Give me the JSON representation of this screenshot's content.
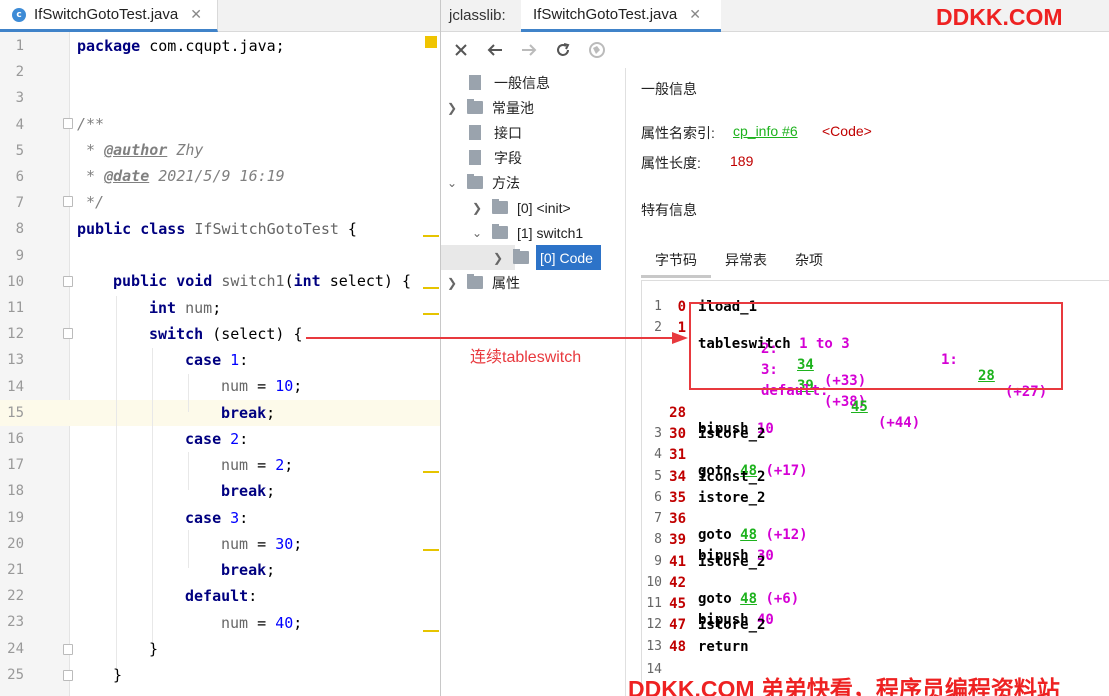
{
  "editor": {
    "tab_label": "IfSwitchGotoTest.java",
    "tab_icon_letter": "c",
    "lines": [
      {
        "n": "1"
      },
      {
        "n": "2"
      },
      {
        "n": "3"
      },
      {
        "n": "4"
      },
      {
        "n": "5"
      },
      {
        "n": "6"
      },
      {
        "n": "7"
      },
      {
        "n": "8"
      },
      {
        "n": "9"
      },
      {
        "n": "10"
      },
      {
        "n": "11"
      },
      {
        "n": "12"
      },
      {
        "n": "13"
      },
      {
        "n": "14"
      },
      {
        "n": "15"
      },
      {
        "n": "16"
      },
      {
        "n": "17"
      },
      {
        "n": "18"
      },
      {
        "n": "19"
      },
      {
        "n": "20"
      },
      {
        "n": "21"
      },
      {
        "n": "22"
      },
      {
        "n": "23"
      },
      {
        "n": "24"
      },
      {
        "n": "25"
      }
    ],
    "code": {
      "l1_kw": "package",
      "l1_rest": " com.cqupt.java;",
      "l4": "/**",
      "l5_pre": " * ",
      "l5_tag": "@author",
      "l5_val": " Zhy",
      "l6_pre": " * ",
      "l6_tag": "@date",
      "l6_val": " 2021/5/9 16:19",
      "l7": " */",
      "l8_kw": "public class",
      "l8_name": " IfSwitchGotoTest",
      "l8_rest": " {",
      "l10_kw": "public void",
      "l10_name": " switch1",
      "l10_p1": "(",
      "l10_kw2": "int",
      "l10_rest": " select) {",
      "l11_kw": "int",
      "l11_var": " num",
      "l11_rest": ";",
      "l12_kw": "switch",
      "l12_rest": " (select) {",
      "l13_kw": "case",
      "l13_num": " 1",
      "l13_rest": ":",
      "l14_var": "num",
      "l14_eq": " = ",
      "l14_num": "10",
      "l14_rest": ";",
      "l15_kw": "break",
      "l15_rest": ";",
      "l16_kw": "case",
      "l16_num": " 2",
      "l16_rest": ":",
      "l17_var": "num",
      "l17_eq": " = ",
      "l17_num": "2",
      "l17_rest": ";",
      "l18_kw": "break",
      "l18_rest": ";",
      "l19_kw": "case",
      "l19_num": " 3",
      "l19_rest": ":",
      "l20_var": "num",
      "l20_eq": " = ",
      "l20_num": "30",
      "l20_rest": ";",
      "l21_kw": "break",
      "l21_rest": ";",
      "l22_kw": "default",
      "l22_rest": ":",
      "l23_var": "num",
      "l23_eq": " = ",
      "l23_num": "40",
      "l23_rest": ";",
      "l24": "}",
      "l25": "}"
    }
  },
  "jclasslib": {
    "title": "jclasslib:",
    "tab_label": "IfSwitchGotoTest.java",
    "toolbar_icons": [
      "close-icon",
      "back-icon",
      "forward-icon",
      "refresh-icon",
      "web-icon"
    ],
    "tree": {
      "general": "一般信息",
      "constant_pool": "常量池",
      "interfaces": "接口",
      "fields": "字段",
      "methods": "方法",
      "init": "[0] <init>",
      "switch1": "[1] switch1",
      "code": "[0] Code",
      "attributes": "属性"
    },
    "detail": {
      "general_title": "一般信息",
      "attr_name_label": "属性名索引:",
      "attr_name_link": "cp_info #6",
      "attr_name_value": "<Code>",
      "attr_len_label": "属性长度:",
      "attr_len_value": "189",
      "special_title": "特有信息",
      "subtabs": [
        "字节码",
        "异常表",
        "杂项"
      ]
    },
    "bytecode": [
      {
        "idx": "1",
        "off": "0",
        "ins": "iload_1"
      },
      {
        "idx": "2",
        "off": "1",
        "ins": "tableswitch",
        "range": " 1 to 3",
        "c1": "1:",
        "c1t": "28",
        "c1d": "(+27)"
      },
      {
        "c": "2:",
        "t": "34",
        "d": "(+33)"
      },
      {
        "c": "3:",
        "t": "39",
        "d": "(+38)"
      },
      {
        "c": "default:",
        "t": "45",
        "d": "(+44)"
      },
      {
        "idx": "",
        "off": "28",
        "ins": "bipush",
        "arg": " 10"
      },
      {
        "idx": "3",
        "off": "30",
        "ins": "istore_2"
      },
      {
        "idx": "4",
        "off": "31",
        "ins": "goto",
        "t": "48",
        "d": "(+17)"
      },
      {
        "idx": "5",
        "off": "34",
        "ins": "iconst_2"
      },
      {
        "idx": "6",
        "off": "35",
        "ins": "istore_2"
      },
      {
        "idx": "7",
        "off": "36",
        "ins": "goto",
        "t": "48",
        "d": "(+12)"
      },
      {
        "idx": "8",
        "off": "39",
        "ins": "bipush",
        "arg": " 30"
      },
      {
        "idx": "9",
        "off": "41",
        "ins": "istore_2"
      },
      {
        "idx": "10",
        "off": "42",
        "ins": "goto",
        "t": "48",
        "d": "(+6)"
      },
      {
        "idx": "11",
        "off": "45",
        "ins": "bipush",
        "arg": " 40"
      },
      {
        "idx": "12",
        "off": "47",
        "ins": "istore_2"
      },
      {
        "idx": "13",
        "off": "48",
        "ins": "return"
      },
      {
        "idx": "14"
      }
    ]
  },
  "annotation": "连续tableswitch",
  "watermark_top": "DDKK.COM",
  "watermark_bottom": "DDKK.COM 弟弟快看，程序员编程资料站",
  "colors": {
    "accent": "#4083c9",
    "selection": "#2d73c8",
    "annotation_red": "#e8393e",
    "link_green": "#1db21d",
    "offset_red": "#c00000",
    "magenta": "#d400d4"
  }
}
